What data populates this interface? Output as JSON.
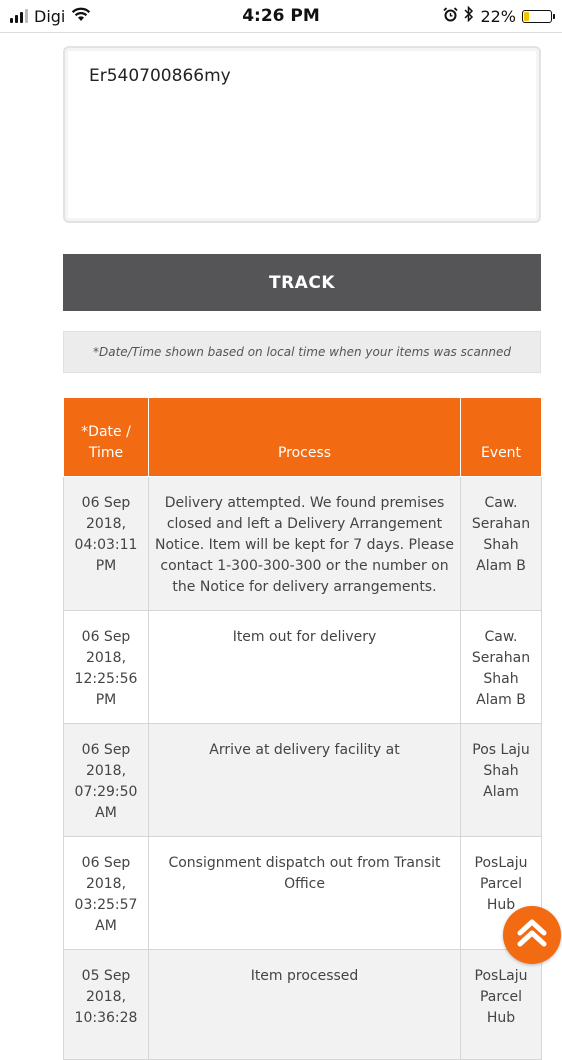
{
  "status_bar": {
    "carrier": "Digi",
    "time": "4:26 PM",
    "battery": "22%",
    "battery_level": 0.22
  },
  "tracking": {
    "value": "Er540700866my"
  },
  "track_button": {
    "label": "TRACK"
  },
  "note": "*Date/Time shown based on local time when your items was scanned",
  "table": {
    "headers": [
      "*Date / Time",
      "Process",
      "Event"
    ],
    "rows": [
      {
        "datetime": "06 Sep 2018, 04:03:11 PM",
        "process": "Delivery attempted. We found premises closed and left a Delivery Arrangement Notice. Item will be kept for 7 days. Please contact 1-300-300-300 or the number on the Notice for delivery arrangements.",
        "event": "Caw. Serahan Shah Alam B"
      },
      {
        "datetime": "06 Sep 2018, 12:25:56 PM",
        "process": "Item out for delivery",
        "event": "Caw. Serahan Shah Alam B"
      },
      {
        "datetime": "06 Sep 2018, 07:29:50 AM",
        "process": "Arrive at delivery facility at",
        "event": "Pos Laju Shah Alam"
      },
      {
        "datetime": "06 Sep 2018, 03:25:57 AM",
        "process": "Consignment dispatch out from Transit Office",
        "event": "PosLaju Parcel Hub"
      },
      {
        "datetime": "05 Sep 2018, 10:36:28",
        "process": "Item processed",
        "event": "PosLaju Parcel Hub"
      }
    ]
  },
  "colors": {
    "accent": "#f26b12",
    "button": "#555557"
  },
  "icons": {
    "signal": "signal-bars-icon",
    "wifi": "wifi-icon",
    "alarm": "alarm-clock-icon",
    "bluetooth": "bluetooth-icon",
    "battery": "battery-icon",
    "scroll_top": "chevron-up-icon"
  }
}
